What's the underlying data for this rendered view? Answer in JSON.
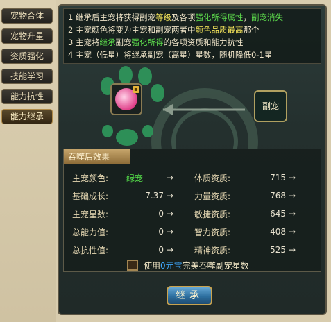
{
  "sidebar": {
    "items": [
      {
        "label": "宠物合体"
      },
      {
        "label": "宠物升星"
      },
      {
        "label": "资质强化"
      },
      {
        "label": "技能学习"
      },
      {
        "label": "能力抗性"
      },
      {
        "label": "能力继承"
      }
    ],
    "active_index": 5
  },
  "rules": [
    {
      "prefix": "1 继承后主宠将获得副宠",
      "h1": "等级",
      "mid": "及各项",
      "h2": "强化所得属性",
      "end": "，",
      "h3": "副宠消失"
    },
    {
      "prefix": "2 主宠颜色将变为主宠和副宠两者中",
      "h1": "颜色品质最高",
      "mid": "那个",
      "h2": "",
      "end": "",
      "h3": ""
    },
    {
      "prefix": "3 主宠将",
      "h1": "继承",
      "mid": "副宠",
      "h2": "强化所得",
      "end": "的各项资质和能力抗性",
      "h3": ""
    },
    {
      "prefix": "4 主宠（低星）将继承副宠（高星）星数，随机降低0-1星",
      "h1": "",
      "mid": "",
      "h2": "",
      "end": "",
      "h3": ""
    }
  ],
  "vice_label": "副宠",
  "result": {
    "title": "吞噬后效果",
    "left": [
      {
        "label": "主宠颜色:",
        "value": "绿宠",
        "arrow": "→"
      },
      {
        "label": "基础成长:",
        "value": "7.37",
        "arrow": "→"
      },
      {
        "label": "主宠星数:",
        "value": "0",
        "arrow": "→"
      },
      {
        "label": "总能力值:",
        "value": "0",
        "arrow": "→"
      },
      {
        "label": "总抗性值:",
        "value": "0",
        "arrow": "→"
      }
    ],
    "right": [
      {
        "label": "体质资质:",
        "value": "715",
        "arrow": "→"
      },
      {
        "label": "力量资质:",
        "value": "768",
        "arrow": "→"
      },
      {
        "label": "敏捷资质:",
        "value": "645",
        "arrow": "→"
      },
      {
        "label": "智力资质:",
        "value": "408",
        "arrow": "→"
      },
      {
        "label": "精神资质:",
        "value": "525",
        "arrow": "→"
      }
    ]
  },
  "use_option": {
    "prefix": "使用",
    "highlight": "0元宝",
    "suffix": "完美吞噬副宠星数"
  },
  "inherit_button": "继承",
  "colors": {
    "highlight_yellow": "#f3e35a",
    "highlight_green": "#5ddc4c",
    "highlight_blue": "#3fa9ff"
  }
}
